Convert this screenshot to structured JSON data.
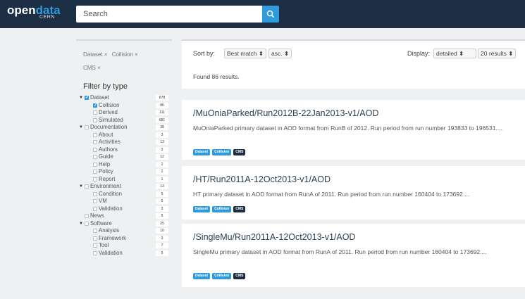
{
  "header": {
    "logo_open": "open",
    "logo_data": "data",
    "logo_sub": "CERN",
    "search_placeholder": "Search"
  },
  "sidebar": {
    "chips": [
      "Dataset ×",
      "Collision ×",
      "CMS ×"
    ],
    "filter_title": "Filter by type",
    "facets": [
      {
        "label": "Dataset",
        "count": "878",
        "level": 0,
        "expanded": true,
        "checked": true
      },
      {
        "label": "Collision",
        "count": "86",
        "level": 1,
        "checked": true
      },
      {
        "label": "Derived",
        "count": "111",
        "level": 1,
        "checked": false
      },
      {
        "label": "Simulated",
        "count": "681",
        "level": 1,
        "checked": false
      },
      {
        "label": "Documentation",
        "count": "38",
        "level": 0,
        "expanded": true,
        "checked": false
      },
      {
        "label": "About",
        "count": "3",
        "level": 1,
        "checked": false
      },
      {
        "label": "Activities",
        "count": "13",
        "level": 1,
        "checked": false
      },
      {
        "label": "Authors",
        "count": "3",
        "level": 1,
        "checked": false
      },
      {
        "label": "Guide",
        "count": "12",
        "level": 1,
        "checked": false
      },
      {
        "label": "Help",
        "count": "2",
        "level": 1,
        "checked": false
      },
      {
        "label": "Policy",
        "count": "2",
        "level": 1,
        "checked": false
      },
      {
        "label": "Report",
        "count": "1",
        "level": 1,
        "checked": false
      },
      {
        "label": "Environment",
        "count": "13",
        "level": 0,
        "expanded": true,
        "checked": false
      },
      {
        "label": "Condition",
        "count": "5",
        "level": 1,
        "checked": false
      },
      {
        "label": "VM",
        "count": "5",
        "level": 1,
        "checked": false
      },
      {
        "label": "Validation",
        "count": "3",
        "level": 1,
        "checked": false
      },
      {
        "label": "News",
        "count": "5",
        "level": 0,
        "expanded": false,
        "checked": false
      },
      {
        "label": "Software",
        "count": "25",
        "level": 0,
        "expanded": true,
        "checked": false
      },
      {
        "label": "Analysis",
        "count": "10",
        "level": 1,
        "checked": false
      },
      {
        "label": "Framework",
        "count": "3",
        "level": 1,
        "checked": false
      },
      {
        "label": "Tool",
        "count": "7",
        "level": 1,
        "checked": false
      },
      {
        "label": "Validation",
        "count": "5",
        "level": 1,
        "checked": false
      }
    ]
  },
  "sort": {
    "label": "Sort by:",
    "sort_value": "Best match ⬍",
    "order_value": "asc. ⬍",
    "display_label": "Display:",
    "display_value": "detailed ⬍",
    "page_size_value": "20 results ⬍",
    "found_text": "Found 86 results."
  },
  "results": [
    {
      "title": "/MuOniaParked/Run2012B-22Jan2013-v1/AOD",
      "desc": "MuOniaParked primary dataset in AOD format from RunB of 2012. Run period from run number 193833 to 196531....",
      "badges": [
        "Dataset",
        "Collision",
        "CMS"
      ]
    },
    {
      "title": "/HT/Run2011A-12Oct2013-v1/AOD",
      "desc": "HT primary dataset in AOD format from RunA of 2011. Run period from run number 160404 to 173692....",
      "badges": [
        "Dataset",
        "Collision",
        "CMS"
      ]
    },
    {
      "title": "/SingleMu/Run2011A-12Oct2013-v1/AOD",
      "desc": "SingleMu primary dataset in AOD format from RunA of 2011. Run period from run number 160404 to 173692....",
      "badges": [
        "Dataset",
        "Collision",
        "CMS"
      ]
    }
  ]
}
